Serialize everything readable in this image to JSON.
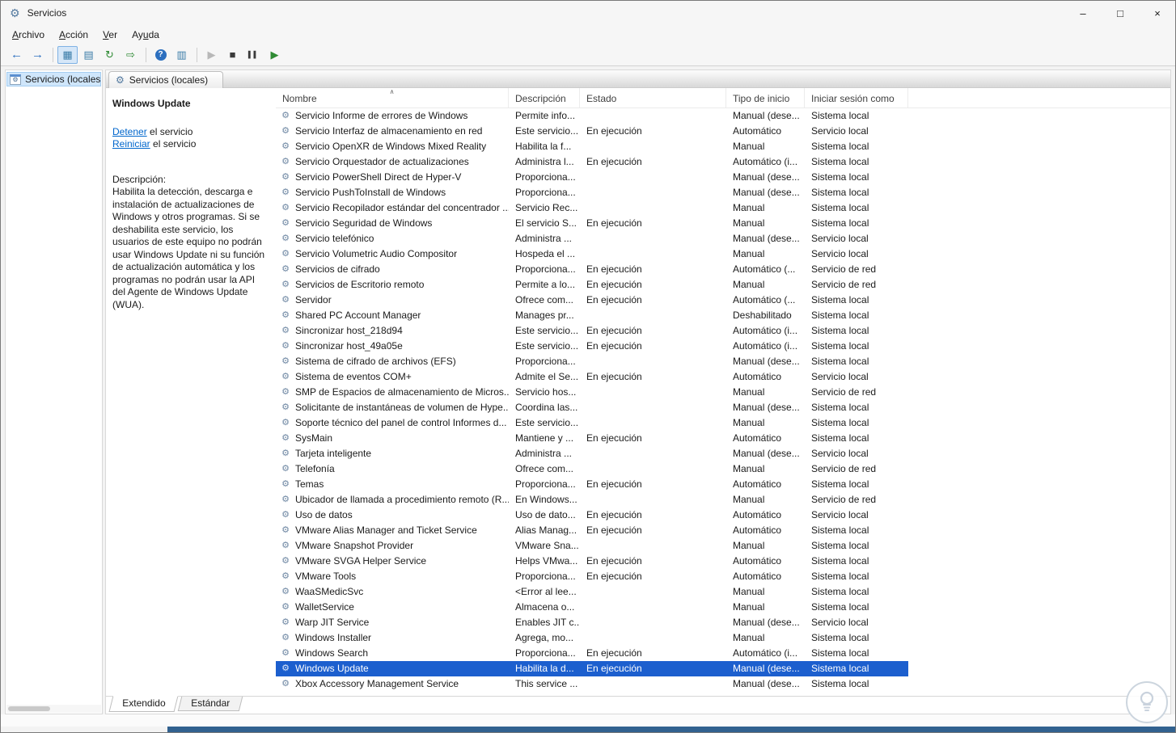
{
  "window": {
    "title": "Servicios",
    "minimize_glyph": "–",
    "maximize_glyph": "□",
    "close_glyph": "×"
  },
  "icons": {
    "gear": "⚙",
    "sort_caret": "∧"
  },
  "colors": {
    "selection": "#1c5fce",
    "link": "#0066cc",
    "taskbar": "#31618f"
  },
  "menu": {
    "items": [
      {
        "pre": "",
        "key": "A",
        "post": "rchivo"
      },
      {
        "pre": "",
        "key": "A",
        "post": "cción"
      },
      {
        "pre": "",
        "key": "V",
        "post": "er"
      },
      {
        "pre": "Ay",
        "key": "u",
        "post": "da"
      }
    ]
  },
  "toolbar": {
    "buttons": [
      {
        "name": "back",
        "glyph": "←",
        "cls": "blue"
      },
      {
        "name": "forward",
        "glyph": "→",
        "cls": "blue"
      },
      {
        "sep": true
      },
      {
        "name": "show-console-tree",
        "glyph": "▦",
        "cls": "teal",
        "state": "active"
      },
      {
        "name": "properties",
        "glyph": "▤",
        "cls": "teal"
      },
      {
        "name": "refresh",
        "glyph": "↻",
        "cls": "green"
      },
      {
        "name": "export-list",
        "glyph": "⇨",
        "cls": "green"
      },
      {
        "sep": true
      },
      {
        "name": "help",
        "glyph": "?",
        "cls": "help"
      },
      {
        "name": "show-action-pane",
        "glyph": "▥",
        "cls": "teal"
      },
      {
        "sep": true
      },
      {
        "name": "start-service",
        "glyph": "▶",
        "cls": "disabled"
      },
      {
        "name": "stop-service",
        "glyph": "■",
        "cls": "dark"
      },
      {
        "name": "pause-service",
        "glyph": "▌▌",
        "cls": "dark small"
      },
      {
        "name": "restart-service",
        "glyph": "▶",
        "cls": "green"
      }
    ]
  },
  "tree": {
    "root_label": "Servicios (locales)"
  },
  "panel": {
    "tab_label": "Servicios (locales)"
  },
  "detail": {
    "service_name": "Windows Update",
    "stop": {
      "link": "Detener",
      "rest": " el servicio"
    },
    "restart": {
      "link": "Reiniciar",
      "rest": " el servicio"
    },
    "description_label": "Descripción:",
    "description": "Habilita la detección, descarga e instalación de actualizaciones de Windows y otros programas. Si se deshabilita este servicio, los usuarios de este equipo no podrán usar Windows Update ni su función de actualización automática y los programas no podrán usar la API del Agente de Windows Update (WUA)."
  },
  "table": {
    "columns": [
      "Nombre",
      "Descripción",
      "Estado",
      "Tipo de inicio",
      "Iniciar sesión como"
    ],
    "selected_index": 36,
    "rows": [
      {
        "name": "Servicio Informe de errores de Windows",
        "desc": "Permite info...",
        "estado": "",
        "inicio": "Manual (dese...",
        "sesion": "Sistema local"
      },
      {
        "name": "Servicio Interfaz de almacenamiento en red",
        "desc": "Este servicio...",
        "estado": "En ejecución",
        "inicio": "Automático",
        "sesion": "Servicio local"
      },
      {
        "name": "Servicio OpenXR de Windows Mixed Reality",
        "desc": "Habilita la f...",
        "estado": "",
        "inicio": "Manual",
        "sesion": "Sistema local"
      },
      {
        "name": "Servicio Orquestador de actualizaciones",
        "desc": "Administra l...",
        "estado": "En ejecución",
        "inicio": "Automático (i...",
        "sesion": "Sistema local"
      },
      {
        "name": "Servicio PowerShell Direct de Hyper-V",
        "desc": "Proporciona...",
        "estado": "",
        "inicio": "Manual (dese...",
        "sesion": "Sistema local"
      },
      {
        "name": "Servicio PushToInstall de Windows",
        "desc": "Proporciona...",
        "estado": "",
        "inicio": "Manual (dese...",
        "sesion": "Sistema local"
      },
      {
        "name": "Servicio Recopilador estándar del concentrador ...",
        "desc": "Servicio Rec...",
        "estado": "",
        "inicio": "Manual",
        "sesion": "Sistema local"
      },
      {
        "name": "Servicio Seguridad de Windows",
        "desc": "El servicio S...",
        "estado": "En ejecución",
        "inicio": "Manual",
        "sesion": "Sistema local"
      },
      {
        "name": "Servicio telefónico",
        "desc": "Administra ...",
        "estado": "",
        "inicio": "Manual (dese...",
        "sesion": "Servicio local"
      },
      {
        "name": "Servicio Volumetric Audio Compositor",
        "desc": "Hospeda el ...",
        "estado": "",
        "inicio": "Manual",
        "sesion": "Servicio local"
      },
      {
        "name": "Servicios de cifrado",
        "desc": "Proporciona...",
        "estado": "En ejecución",
        "inicio": "Automático (...",
        "sesion": "Servicio de red"
      },
      {
        "name": "Servicios de Escritorio remoto",
        "desc": "Permite a lo...",
        "estado": "En ejecución",
        "inicio": "Manual",
        "sesion": "Servicio de red"
      },
      {
        "name": "Servidor",
        "desc": "Ofrece com...",
        "estado": "En ejecución",
        "inicio": "Automático (...",
        "sesion": "Sistema local"
      },
      {
        "name": "Shared PC Account Manager",
        "desc": "Manages pr...",
        "estado": "",
        "inicio": "Deshabilitado",
        "sesion": "Sistema local"
      },
      {
        "name": "Sincronizar host_218d94",
        "desc": "Este servicio...",
        "estado": "En ejecución",
        "inicio": "Automático (i...",
        "sesion": "Sistema local"
      },
      {
        "name": "Sincronizar host_49a05e",
        "desc": "Este servicio...",
        "estado": "En ejecución",
        "inicio": "Automático (i...",
        "sesion": "Sistema local"
      },
      {
        "name": "Sistema de cifrado de archivos (EFS)",
        "desc": "Proporciona...",
        "estado": "",
        "inicio": "Manual (dese...",
        "sesion": "Sistema local"
      },
      {
        "name": "Sistema de eventos COM+",
        "desc": "Admite el Se...",
        "estado": "En ejecución",
        "inicio": "Automático",
        "sesion": "Servicio local"
      },
      {
        "name": "SMP de Espacios de almacenamiento de Micros...",
        "desc": "Servicio hos...",
        "estado": "",
        "inicio": "Manual",
        "sesion": "Servicio de red"
      },
      {
        "name": "Solicitante de instantáneas de volumen de Hype...",
        "desc": "Coordina las...",
        "estado": "",
        "inicio": "Manual (dese...",
        "sesion": "Sistema local"
      },
      {
        "name": "Soporte técnico del panel de control Informes d...",
        "desc": "Este servicio...",
        "estado": "",
        "inicio": "Manual",
        "sesion": "Sistema local"
      },
      {
        "name": "SysMain",
        "desc": "Mantiene y ...",
        "estado": "En ejecución",
        "inicio": "Automático",
        "sesion": "Sistema local"
      },
      {
        "name": "Tarjeta inteligente",
        "desc": "Administra ...",
        "estado": "",
        "inicio": "Manual (dese...",
        "sesion": "Servicio local"
      },
      {
        "name": "Telefonía",
        "desc": "Ofrece com...",
        "estado": "",
        "inicio": "Manual",
        "sesion": "Servicio de red"
      },
      {
        "name": "Temas",
        "desc": "Proporciona...",
        "estado": "En ejecución",
        "inicio": "Automático",
        "sesion": "Sistema local"
      },
      {
        "name": "Ubicador de llamada a procedimiento remoto (R...",
        "desc": "En Windows...",
        "estado": "",
        "inicio": "Manual",
        "sesion": "Servicio de red"
      },
      {
        "name": "Uso de datos",
        "desc": "Uso de dato...",
        "estado": "En ejecución",
        "inicio": "Automático",
        "sesion": "Servicio local"
      },
      {
        "name": "VMware Alias Manager and Ticket Service",
        "desc": "Alias Manag...",
        "estado": "En ejecución",
        "inicio": "Automático",
        "sesion": "Sistema local"
      },
      {
        "name": "VMware Snapshot Provider",
        "desc": "VMware Sna...",
        "estado": "",
        "inicio": "Manual",
        "sesion": "Sistema local"
      },
      {
        "name": "VMware SVGA Helper Service",
        "desc": "Helps VMwa...",
        "estado": "En ejecución",
        "inicio": "Automático",
        "sesion": "Sistema local"
      },
      {
        "name": "VMware Tools",
        "desc": "Proporciona...",
        "estado": "En ejecución",
        "inicio": "Automático",
        "sesion": "Sistema local"
      },
      {
        "name": "WaaSMedicSvc",
        "desc": "<Error al lee...",
        "estado": "",
        "inicio": "Manual",
        "sesion": "Sistema local"
      },
      {
        "name": "WalletService",
        "desc": "Almacena o...",
        "estado": "",
        "inicio": "Manual",
        "sesion": "Sistema local"
      },
      {
        "name": "Warp JIT Service",
        "desc": "Enables JIT c...",
        "estado": "",
        "inicio": "Manual (dese...",
        "sesion": "Servicio local"
      },
      {
        "name": "Windows Installer",
        "desc": "Agrega, mo...",
        "estado": "",
        "inicio": "Manual",
        "sesion": "Sistema local"
      },
      {
        "name": "Windows Search",
        "desc": "Proporciona...",
        "estado": "En ejecución",
        "inicio": "Automático (i...",
        "sesion": "Sistema local"
      },
      {
        "name": "Windows Update",
        "desc": "Habilita la d...",
        "estado": "En ejecución",
        "inicio": "Manual (dese...",
        "sesion": "Sistema local"
      },
      {
        "name": "Xbox Accessory Management Service",
        "desc": "This service ...",
        "estado": "",
        "inicio": "Manual (dese...",
        "sesion": "Sistema local"
      }
    ]
  },
  "footer": {
    "tabs": [
      "Extendido",
      "Estándar"
    ],
    "selected": 0
  }
}
